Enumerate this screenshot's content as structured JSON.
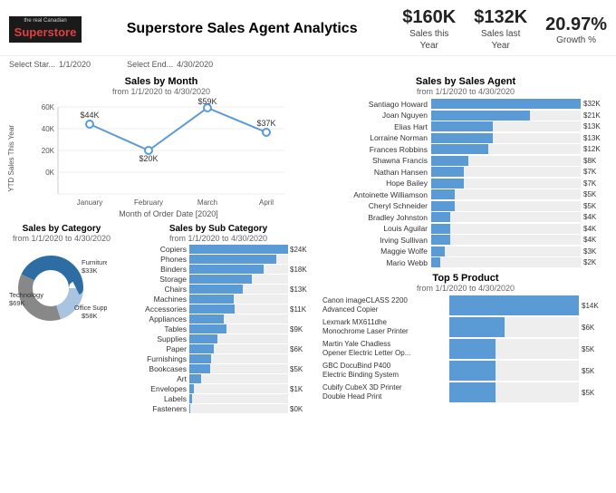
{
  "header": {
    "logo_top": "the real Canadian",
    "logo_name": "Superstore",
    "title": "Superstore Sales Agent Analytics",
    "kpi1": {
      "value": "$160K",
      "label1": "Sales this",
      "label2": "Year"
    },
    "kpi2": {
      "value": "$132K",
      "label1": "Sales last",
      "label2": "Year"
    },
    "kpi3": {
      "value": "20.97%",
      "label1": "Growth %"
    }
  },
  "filters": {
    "start_label": "Select Star...",
    "start_date": "1/1/2020",
    "end_label": "Select End...",
    "end_date": "4/30/2020"
  },
  "line_chart": {
    "title": "Sales by Month",
    "subtitle": "from 1/1/2020 to 4/30/2020",
    "y_label": "YTD Sales This Year",
    "x_label": "Month of Order Date [2020]",
    "points": [
      {
        "month": "January",
        "value": 44,
        "label": "$44K"
      },
      {
        "month": "February",
        "value": 20,
        "label": "$20K"
      },
      {
        "month": "March",
        "value": 59,
        "label": "$59K"
      },
      {
        "month": "April",
        "value": 37,
        "label": "$37K"
      }
    ],
    "y_ticks": [
      "0K",
      "20K",
      "40K",
      "60K"
    ]
  },
  "category": {
    "title": "Sales by Category",
    "subtitle": "from 1/1/2020 to 4/30/2020",
    "segments": [
      {
        "label": "Furniture",
        "value": "$33K",
        "pct": 20,
        "color": "#a8c4e0"
      },
      {
        "label": "Technology",
        "value": "$69K",
        "pct": 43,
        "color": "#2e6da4"
      },
      {
        "label": "Office Supplies",
        "value": "$58K",
        "pct": 37,
        "color": "#888"
      }
    ]
  },
  "subcategory": {
    "title": "Sales by Sub Category",
    "subtitle": "from 1/1/2020 to 4/30/2020",
    "items": [
      {
        "label": "Copiers",
        "value": "$24K",
        "pct": 100
      },
      {
        "label": "Phones",
        "value": "",
        "pct": 88
      },
      {
        "label": "Binders",
        "value": "$18K",
        "pct": 75
      },
      {
        "label": "Storage",
        "value": "",
        "pct": 63
      },
      {
        "label": "Chairs",
        "value": "$13K",
        "pct": 54
      },
      {
        "label": "Machines",
        "value": "",
        "pct": 45
      },
      {
        "label": "Accessories",
        "value": "$11K",
        "pct": 46
      },
      {
        "label": "Appliances",
        "value": "",
        "pct": 35
      },
      {
        "label": "Tables",
        "value": "$9K",
        "pct": 38
      },
      {
        "label": "Supplies",
        "value": "",
        "pct": 28
      },
      {
        "label": "Paper",
        "value": "$6K",
        "pct": 25
      },
      {
        "label": "Furnishings",
        "value": "",
        "pct": 22
      },
      {
        "label": "Bookcases",
        "value": "$5K",
        "pct": 21
      },
      {
        "label": "Art",
        "value": "",
        "pct": 12
      },
      {
        "label": "Envelopes",
        "value": "$1K",
        "pct": 5
      },
      {
        "label": "Labels",
        "value": "",
        "pct": 3
      },
      {
        "label": "Fasteners",
        "value": "$0K",
        "pct": 1
      }
    ]
  },
  "agent": {
    "title": "Sales by Sales Agent",
    "subtitle": "from 1/1/2020 to 4/30/2020",
    "items": [
      {
        "label": "Santiago Howard",
        "value": "$32K",
        "pct": 100
      },
      {
        "label": "Joan Nguyen",
        "value": "$21K",
        "pct": 66
      },
      {
        "label": "Elias Hart",
        "value": "$13K",
        "pct": 41
      },
      {
        "label": "Lorraine Norman",
        "value": "$13K",
        "pct": 41
      },
      {
        "label": "Frances Robbins",
        "value": "$12K",
        "pct": 38
      },
      {
        "label": "Shawna Francis",
        "value": "$8K",
        "pct": 25
      },
      {
        "label": "Nathan Hansen",
        "value": "$7K",
        "pct": 22
      },
      {
        "label": "Hope Bailey",
        "value": "$7K",
        "pct": 22
      },
      {
        "label": "Antoinette Williamson",
        "value": "$5K",
        "pct": 16
      },
      {
        "label": "Cheryl Schneider",
        "value": "$5K",
        "pct": 16
      },
      {
        "label": "Bradley Johnston",
        "value": "$4K",
        "pct": 13
      },
      {
        "label": "Louis Aguilar",
        "value": "$4K",
        "pct": 13
      },
      {
        "label": "Irving Sullivan",
        "value": "$4K",
        "pct": 13
      },
      {
        "label": "Maggie Wolfe",
        "value": "$3K",
        "pct": 9
      },
      {
        "label": "Mario Webb",
        "value": "$2K",
        "pct": 6
      }
    ]
  },
  "top5": {
    "title": "Top 5 Product",
    "subtitle": "from 1/1/2020 to 4/30/2020",
    "items": [
      {
        "label": "Canon imageCLASS 2200\nAdvanced Copier",
        "value": "$14K",
        "pct": 100
      },
      {
        "label": "Lexmark MX611dhe\nMonochrome Laser Printer",
        "value": "$6K",
        "pct": 43
      },
      {
        "label": "Martin Yale Chadless\nOpener Electric Letter Op...",
        "value": "$5K",
        "pct": 36
      },
      {
        "label": "GBC DocuBind P400\nElectric Binding System",
        "value": "$5K",
        "pct": 36
      },
      {
        "label": "Cubify CubeX 3D Printer\nDouble Head Print",
        "value": "$5K",
        "pct": 36
      }
    ]
  }
}
